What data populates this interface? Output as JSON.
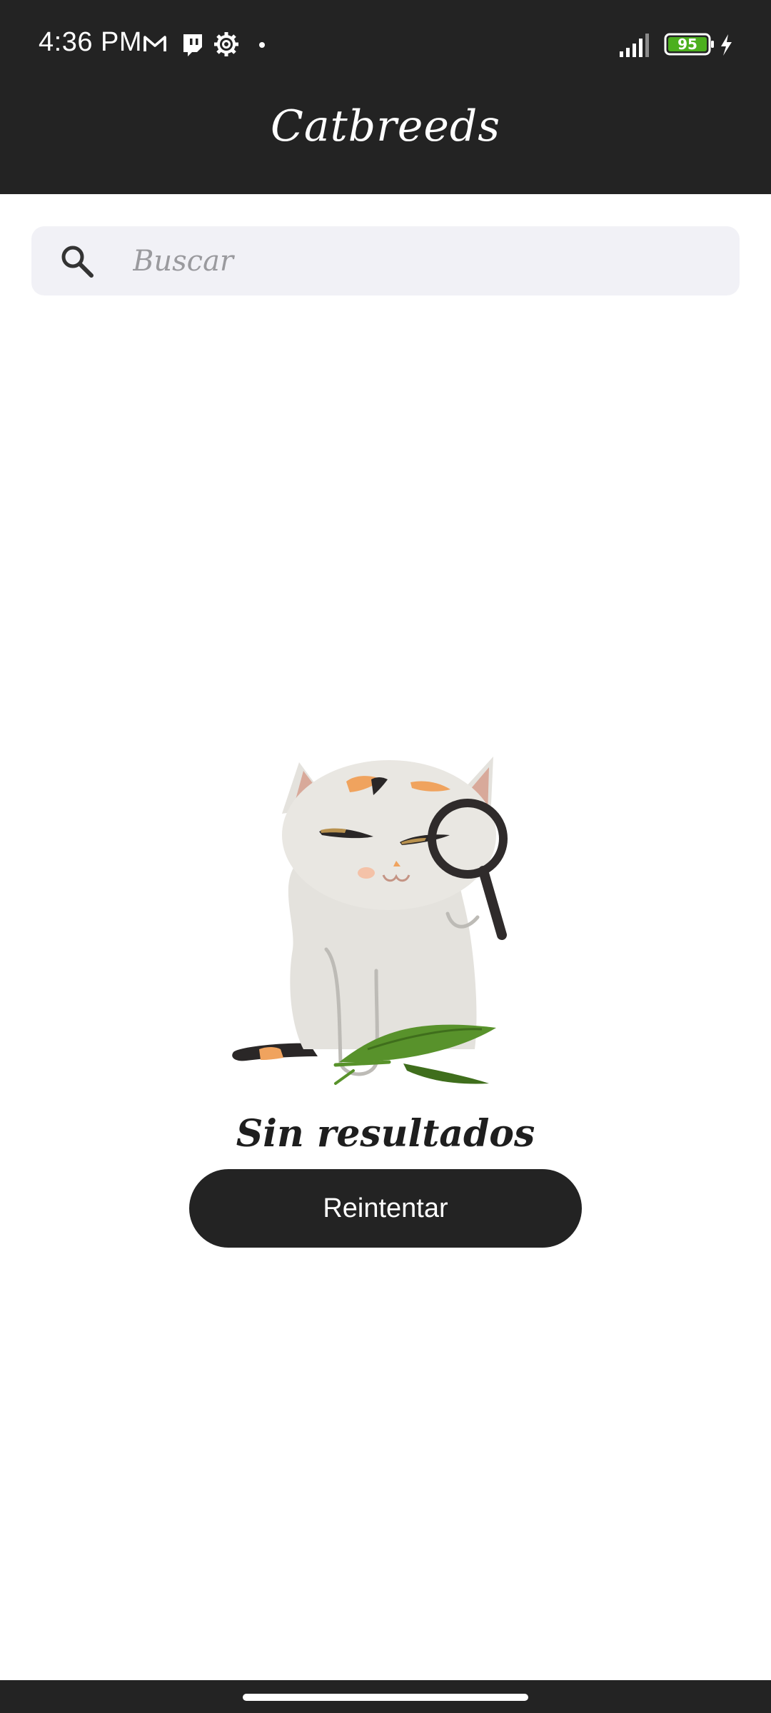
{
  "status_bar": {
    "time": "4:36 PM",
    "battery_level": "95",
    "icons": [
      "gmail-icon",
      "twitch-icon",
      "settings-gear-icon",
      "notification-dot",
      "signal-icon",
      "battery-icon",
      "charging-icon"
    ],
    "battery_color": "#4caf1e"
  },
  "app_bar": {
    "title": "Catbreeds",
    "background": "#232323"
  },
  "search": {
    "placeholder": "Buscar",
    "value": "",
    "icon": "search-icon"
  },
  "empty_state": {
    "illustration": "cat-with-magnifying-glass-illustration",
    "message": "Sin resultados",
    "retry_label": "Reintentar"
  },
  "colors": {
    "accent_dark": "#232323",
    "search_bg": "#f1f1f6",
    "placeholder": "#9a9a9e"
  }
}
